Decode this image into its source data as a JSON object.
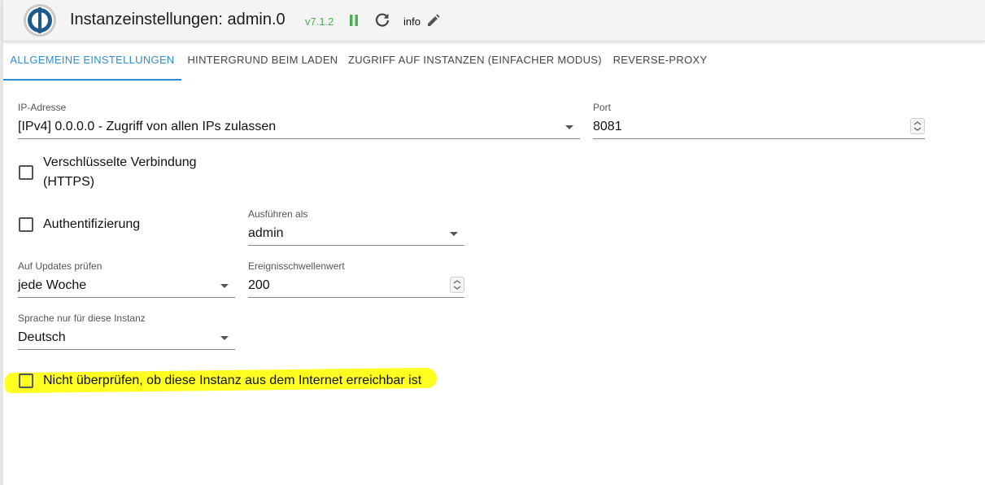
{
  "header": {
    "title": "Instanzeinstellungen: admin.0",
    "version": "v7.1.2",
    "info_label": "info",
    "logo_icon": "iobroker-logo-icon",
    "pause_icon": "pause-icon",
    "reload_icon": "reload-icon",
    "edit_icon": "pencil-icon"
  },
  "tabs": [
    {
      "label": "ALLGEMEINE EINSTELLUNGEN",
      "active": true
    },
    {
      "label": "HINTERGRUND BEIM LADEN",
      "active": false
    },
    {
      "label": "ZUGRIFF AUF INSTANZEN (EINFACHER MODUS)",
      "active": false
    },
    {
      "label": "REVERSE-PROXY",
      "active": false
    }
  ],
  "form": {
    "ip": {
      "label": "IP-Adresse",
      "value": "[IPv4] 0.0.0.0 - Zugriff von allen IPs zulassen"
    },
    "port": {
      "label": "Port",
      "value": "8081"
    },
    "secure": {
      "label_line1": "Verschlüsselte Verbindung",
      "label_line2": "(HTTPS)",
      "checked": false
    },
    "auth": {
      "label": "Authentifizierung",
      "checked": false
    },
    "run_as": {
      "label": "Ausführen als",
      "value": "admin"
    },
    "updates": {
      "label": "Auf Updates prüfen",
      "value": "jede Woche"
    },
    "threshold": {
      "label": "Ereignisschwellenwert",
      "value": "200"
    },
    "language": {
      "label": "Sprache nur für diese Instanz",
      "value": "Deutsch"
    },
    "no_check": {
      "label": "Nicht überprüfen, ob diese Instanz aus dem Internet erreichbar ist",
      "checked": false
    }
  },
  "colors": {
    "accent": "#2d8fd5",
    "version_green": "#4caf50",
    "highlight": "#ffff22",
    "logo_blue": "#1f5a8c"
  }
}
